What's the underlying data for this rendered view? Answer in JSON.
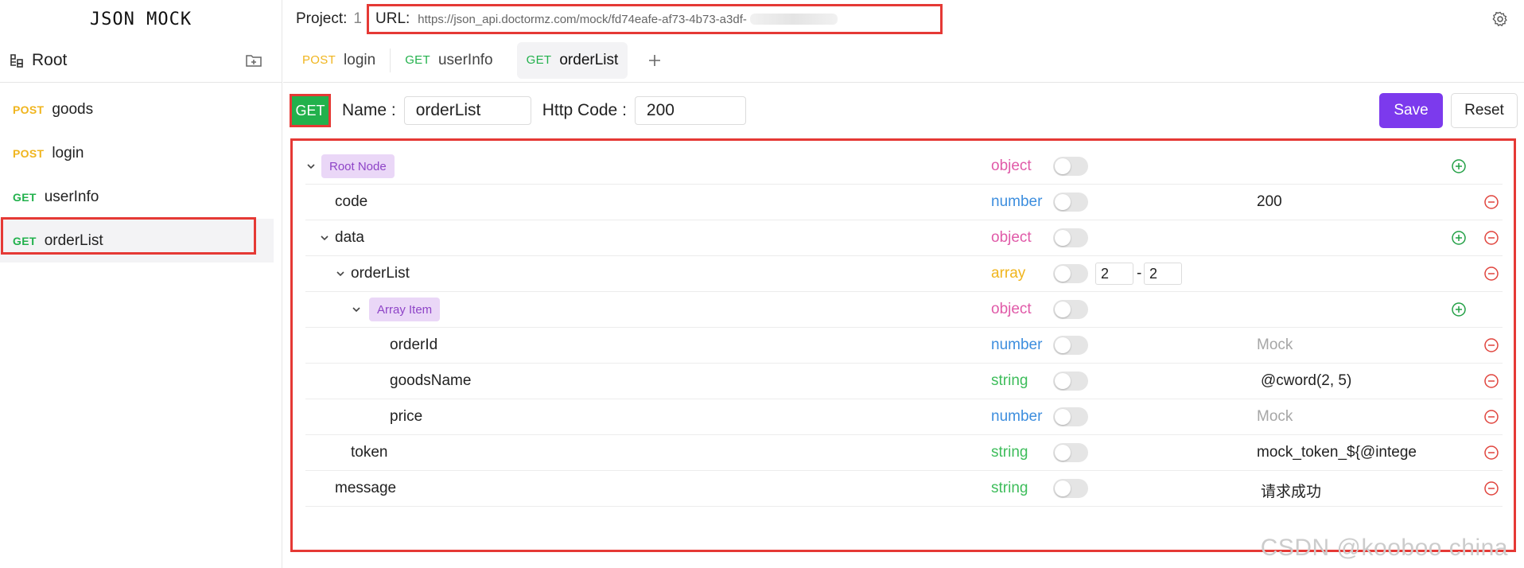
{
  "app": {
    "title": "JSON MOCK"
  },
  "sidebar": {
    "root_label": "Root",
    "items": [
      {
        "method": "POST",
        "name": "goods"
      },
      {
        "method": "POST",
        "name": "login"
      },
      {
        "method": "GET",
        "name": "userInfo"
      },
      {
        "method": "GET",
        "name": "orderList"
      }
    ]
  },
  "header": {
    "project_label": "Project:",
    "project_value": "1",
    "url_label": "URL:",
    "url_value": "https://json_api.doctormz.com/mock/fd74eafe-af73-4b73-a3df-"
  },
  "tabs": [
    {
      "method": "POST",
      "name": "login"
    },
    {
      "method": "GET",
      "name": "userInfo"
    },
    {
      "method": "GET",
      "name": "orderList"
    }
  ],
  "form": {
    "method": "GET",
    "name_label": "Name :",
    "name_value": "orderList",
    "code_label": "Http Code :",
    "code_value": "200",
    "save_label": "Save",
    "reset_label": "Reset"
  },
  "tree": {
    "rows": [
      {
        "label": "Root Node",
        "type": "object",
        "mock": ""
      },
      {
        "label": "code",
        "type": "number",
        "mock": "200"
      },
      {
        "label": "data",
        "type": "object",
        "mock": ""
      },
      {
        "label": "orderList",
        "type": "array",
        "range_min": "2",
        "range_dash": "-",
        "range_max": "2",
        "mock": ""
      },
      {
        "label": "Array Item",
        "type": "object",
        "mock": ""
      },
      {
        "label": "orderId",
        "type": "number",
        "mock": "Mock"
      },
      {
        "label": "goodsName",
        "type": "string",
        "mock": "@cword(2, 5)"
      },
      {
        "label": "price",
        "type": "number",
        "mock": "Mock"
      },
      {
        "label": "token",
        "type": "string",
        "mock": "mock_token_${@intege"
      },
      {
        "label": "message",
        "type": "string",
        "mock": "请求成功"
      }
    ]
  },
  "colors": {
    "post": "#f0b51e",
    "get": "#22b14c",
    "save": "#7c3aed",
    "object": "#e05aa8",
    "number": "#3d8ede",
    "array": "#f0b51e",
    "string": "#3ebd5b"
  },
  "watermark": "CSDN @kooboo china"
}
